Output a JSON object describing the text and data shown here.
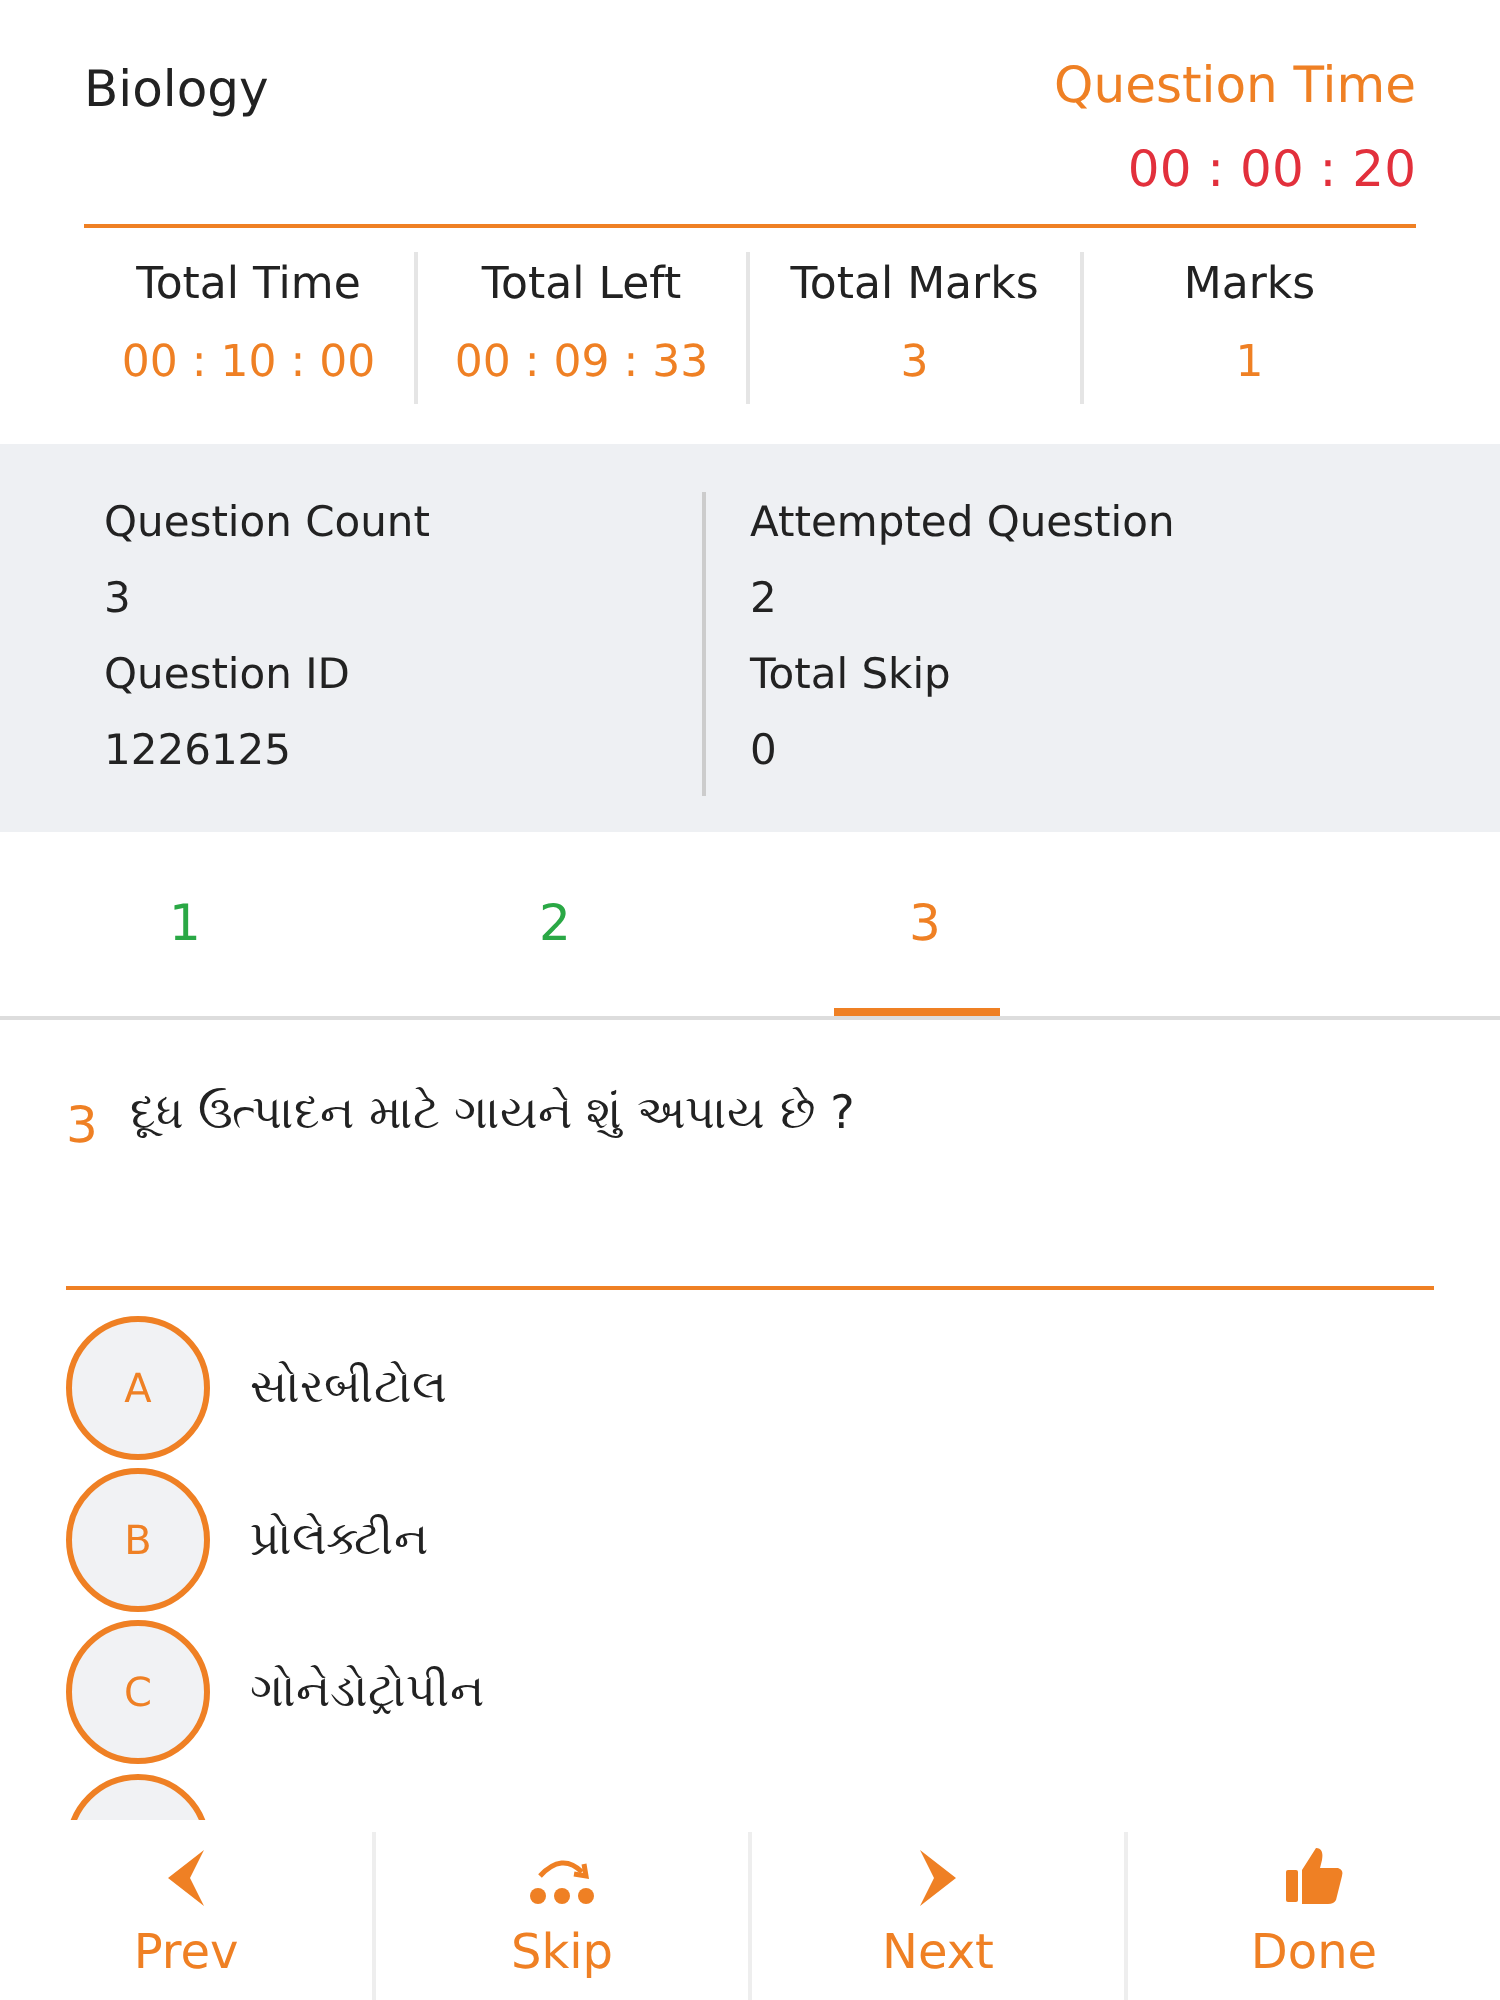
{
  "subject": "Biology",
  "question_time": {
    "label": "Question Time",
    "value": "00 : 00 : 20"
  },
  "stats": [
    {
      "label": "Total Time",
      "value": "00 : 10 : 00"
    },
    {
      "label": "Total Left",
      "value": "00 : 09 : 33"
    },
    {
      "label": "Total Marks",
      "value": "3"
    },
    {
      "label": "Marks",
      "value": "1"
    }
  ],
  "info": [
    {
      "label": "Question Count",
      "value": "3"
    },
    {
      "label": "Attempted Question",
      "value": "2"
    },
    {
      "label": "Question ID",
      "value": "1226125"
    },
    {
      "label": "Total Skip",
      "value": "0"
    }
  ],
  "question_tabs": [
    {
      "label": "1",
      "attempted": true,
      "selected": false
    },
    {
      "label": "2",
      "attempted": true,
      "selected": false
    },
    {
      "label": "3",
      "attempted": false,
      "selected": true
    }
  ],
  "question": {
    "number": "3",
    "text": "દૂધ ઉત્પાદન માટે ગાયને શું અપાય છે ?"
  },
  "options": [
    {
      "letter": "A",
      "text": "સોરબીટોલ",
      "selected": false
    },
    {
      "letter": "B",
      "text": "પ્રોલેક્ટીન",
      "selected": false
    },
    {
      "letter": "C",
      "text": "ગોનેડોટ્રોપીન",
      "selected": false
    }
  ],
  "more_options_cut": true,
  "nav": [
    {
      "kind": "prev",
      "label": "Prev"
    },
    {
      "kind": "skip",
      "label": "Skip"
    },
    {
      "kind": "next",
      "label": "Next"
    },
    {
      "kind": "done",
      "label": "Done"
    }
  ]
}
